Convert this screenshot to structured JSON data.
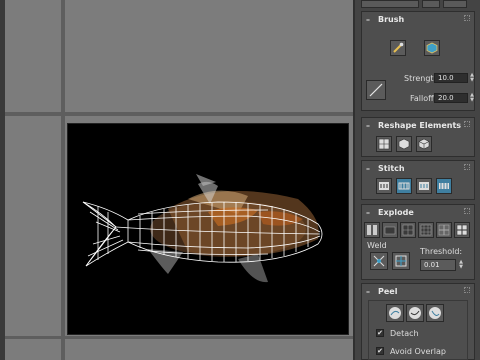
{
  "viewport": {
    "background": "#000000",
    "model": "fish-mesh"
  },
  "panel": {
    "brush": {
      "title": "Brush",
      "strength_label": "Strength:",
      "strength_value": "10.0",
      "falloff_label": "Falloff:",
      "falloff_value": "20.0"
    },
    "reshape": {
      "title": "Reshape Elements"
    },
    "stitch": {
      "title": "Stitch"
    },
    "explode": {
      "title": "Explode",
      "weld_label": "Weld",
      "threshold_label": "Threshold:",
      "threshold_value": "0.01"
    },
    "peel": {
      "title": "Peel",
      "detach_label": "Detach",
      "avoid_overlap_label": "Avoid Overlap"
    },
    "toggle_symbol": "–",
    "check_symbol": "✔"
  },
  "colors": {
    "accent": "#3f7fa0",
    "panel": "#444444",
    "viewport_bg": "#000000"
  }
}
